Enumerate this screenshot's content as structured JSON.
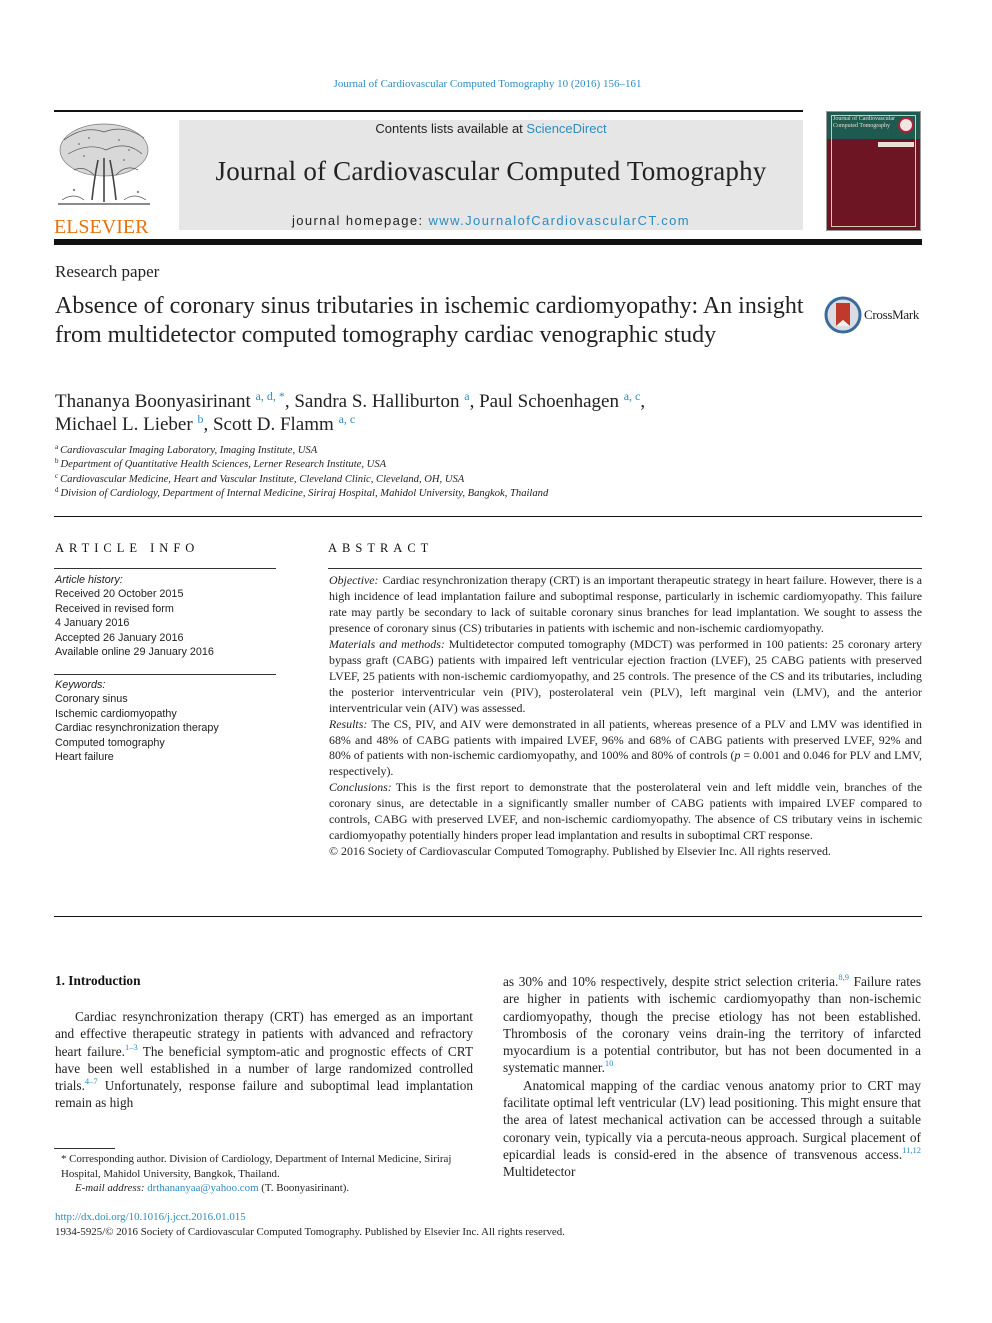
{
  "header": {
    "citation": "Journal of Cardiovascular Computed Tomography 10 (2016) 156–161",
    "contents_prefix": "Contents lists available at ",
    "contents_link": "ScienceDirect",
    "journal_name": "Journal of Cardiovascular Computed Tomography",
    "homepage_prefix": "journal homepage: ",
    "homepage_link": "www.JournalofCardiovascularCT.com",
    "publisher_logo": "ELSEVIER",
    "cover_title": "Journal of Cardiovascular Computed Tomography",
    "colors": {
      "link": "#2b8cbf",
      "elsevier_orange": "#e8730c",
      "cover_maroon": "#6e1523",
      "cover_green": "#1f5a50"
    }
  },
  "article": {
    "section_type": "Research paper",
    "title": "Absence of coronary sinus tributaries in ischemic cardiomyopathy: An insight from multidetector computed tomography cardiac venographic study",
    "crossmark_label": "CrossMark",
    "authors": [
      {
        "name": "Thananya Boonyasirinant",
        "sup": "a, d, *",
        "sep": ", "
      },
      {
        "name": "Sandra S. Halliburton",
        "sup": "a",
        "sep": ", "
      },
      {
        "name": "Paul Schoenhagen",
        "sup": "a, c",
        "sep": ","
      },
      {
        "name": "Michael L. Lieber",
        "sup": "b",
        "sep": ", "
      },
      {
        "name": "Scott D. Flamm",
        "sup": "a, c",
        "sep": ""
      }
    ],
    "affiliations": [
      {
        "key": "a",
        "text": "Cardiovascular Imaging Laboratory, Imaging Institute, USA"
      },
      {
        "key": "b",
        "text": "Department of Quantitative Health Sciences, Lerner Research Institute, USA"
      },
      {
        "key": "c",
        "text": "Cardiovascular Medicine, Heart and Vascular Institute, Cleveland Clinic, Cleveland, OH, USA"
      },
      {
        "key": "d",
        "text": "Division of Cardiology, Department of Internal Medicine, Siriraj Hospital, Mahidol University, Bangkok, Thailand"
      }
    ]
  },
  "article_info": {
    "heading": "ARTICLE INFO",
    "history_label": "Article history:",
    "history": [
      "Received 20 October 2015",
      "Received in revised form",
      "4 January 2016",
      "Accepted 26 January 2016",
      "Available online 29 January 2016"
    ],
    "keywords_label": "Keywords:",
    "keywords": [
      "Coronary sinus",
      "Ischemic cardiomyopathy",
      "Cardiac resynchronization therapy",
      "Computed tomography",
      "Heart failure"
    ]
  },
  "abstract": {
    "heading": "ABSTRACT",
    "objective_label": "Objective:",
    "objective": "Cardiac resynchronization therapy (CRT) is an important therapeutic strategy in heart failure. However, there is a high incidence of lead implantation failure and suboptimal response, particularly in ischemic cardiomyopathy. This failure rate may partly be secondary to lack of suitable coronary sinus branches for lead implantation. We sought to assess the presence of coronary sinus (CS) tributaries in patients with ischemic and non-ischemic cardiomyopathy.",
    "methods_label": "Materials and methods:",
    "methods": "Multidetector computed tomography (MDCT) was performed in 100 patients: 25 coronary artery bypass graft (CABG) patients with impaired left ventricular ejection fraction (LVEF), 25 CABG patients with preserved LVEF, 25 patients with non-ischemic cardiomyopathy, and 25 controls. The presence of the CS and its tributaries, including the posterior interventricular vein (PIV), posterolateral vein (PLV), left marginal vein (LMV), and the anterior interventricular vein (AIV) was assessed.",
    "results_label": "Results:",
    "results_a": "The CS, PIV, and AIV were demonstrated in all patients, whereas presence of a PLV and LMV was identified in 68% and 48% of CABG patients with impaired LVEF, 96% and 68% of CABG patients with preserved LVEF, 92% and 80% of patients with non-ischemic cardiomyopathy, and 100% and 80% of controls (",
    "results_p": "p",
    "results_b": " = 0.001 and 0.046 for PLV and LMV, respectively).",
    "conclusions_label": "Conclusions:",
    "conclusions": "This is the first report to demonstrate that the posterolateral vein and left middle vein, branches of the coronary sinus, are detectable in a significantly smaller number of CABG patients with impaired LVEF compared to controls, CABG with preserved LVEF, and non-ischemic cardiomyopathy. The absence of CS tributary veins in ischemic cardiomyopathy potentially hinders proper lead implantation and results in suboptimal CRT response.",
    "copyright": "© 2016 Society of Cardiovascular Computed Tomography. Published by Elsevier Inc. All rights reserved."
  },
  "body": {
    "intro_heading": "1.  Introduction",
    "left_p1_a": "Cardiac resynchronization therapy (CRT) has emerged as an important and effective therapeutic strategy in patients with advanced and refractory heart failure.",
    "left_ref1": "1–3",
    "left_p1_b": " The beneficial symptom-atic and prognostic effects of CRT have been well established in a number of large randomized controlled trials.",
    "left_ref2": "4–7",
    "left_p1_c": " Unfortunately, response failure and suboptimal lead implantation remain as high",
    "right_p1_a": "as 30% and 10% respectively, despite strict selection criteria.",
    "right_ref1": "8,9",
    "right_p1_b": " Failure rates are higher in patients with ischemic cardiomyopathy than non-ischemic cardiomyopathy, though the precise etiology has not been established. Thrombosis of the coronary veins drain-ing the territory of infarcted myocardium is a potential contributor, but has not been documented in a systematic manner.",
    "right_ref2": "10",
    "right_p2_a": "Anatomical mapping of the cardiac venous anatomy prior to CRT may facilitate optimal left ventricular (LV) lead positioning. This might ensure that the area of latest mechanical activation can be accessed through a suitable coronary vein, typically via a percuta-neous approach. Surgical placement of epicardial leads is consid-ered in the absence of transvenous access.",
    "right_ref3": "11,12",
    "right_p2_b": " Multidetector"
  },
  "footnote": {
    "corresponding": "* Corresponding author. Division of Cardiology, Department of Internal Medicine, Siriraj Hospital, Mahidol University, Bangkok, Thailand.",
    "email_label": "E-mail address:",
    "email": "drthananyaa@yahoo.com",
    "email_suffix": " (T. Boonyasirinant)."
  },
  "footer": {
    "doi": "http://dx.doi.org/10.1016/j.jcct.2016.01.015",
    "issn": "1934-5925/© 2016 Society of Cardiovascular Computed Tomography. Published by Elsevier Inc. All rights reserved."
  }
}
